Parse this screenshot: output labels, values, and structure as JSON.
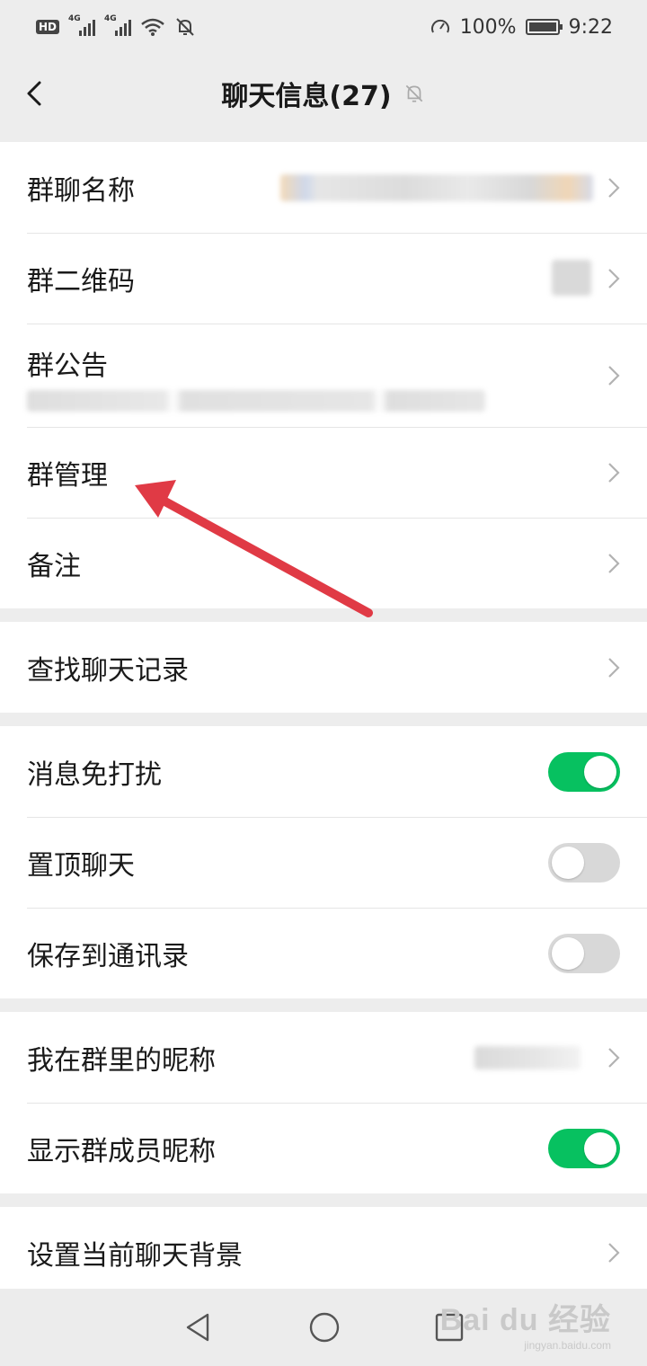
{
  "statusbar": {
    "hd": "HD",
    "net1": "4G",
    "net2": "4G",
    "battery_pct": "100%",
    "time": "9:22"
  },
  "navbar": {
    "title": "聊天信息(27)",
    "back_icon": "chevron-left-icon",
    "mute_icon": "bell-off-icon"
  },
  "groups": {
    "info": {
      "name_label": "群聊名称",
      "qrcode_label": "群二维码",
      "notice_label": "群公告",
      "manage_label": "群管理",
      "remark_label": "备注"
    },
    "search": {
      "search_label": "查找聊天记录"
    },
    "toggles": {
      "dnd_label": "消息免打扰",
      "dnd_on": true,
      "pin_label": "置顶聊天",
      "pin_on": false,
      "save_label": "保存到通讯录",
      "save_on": false
    },
    "nickname": {
      "my_nick_label": "我在群里的昵称",
      "show_nick_label": "显示群成员昵称",
      "show_nick_on": true
    },
    "background": {
      "bg_label": "设置当前聊天背景"
    }
  },
  "colors": {
    "accent": "#07c160",
    "arrow": "#e03a45"
  },
  "watermark": {
    "brand": "Bai du 经验",
    "url": "jingyan.baidu.com"
  }
}
